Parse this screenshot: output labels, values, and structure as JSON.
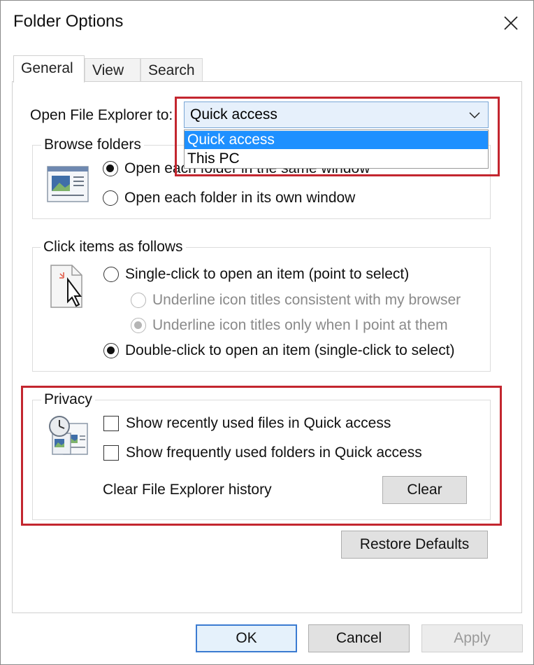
{
  "window": {
    "title": "Folder Options"
  },
  "tabs": [
    {
      "label": "General",
      "active": true
    },
    {
      "label": "View",
      "active": false
    },
    {
      "label": "Search",
      "active": false
    }
  ],
  "open_explorer": {
    "label": "Open File Explorer to:",
    "value": "Quick access",
    "options": [
      "Quick access",
      "This PC"
    ],
    "selected_index": 0
  },
  "browse_folders": {
    "legend": "Browse folders",
    "options": [
      {
        "label": "Open each folder in the same window",
        "checked": true
      },
      {
        "label": "Open each folder in its own window",
        "checked": false
      }
    ]
  },
  "click_items": {
    "legend": "Click items as follows",
    "options": [
      {
        "label": "Single-click to open an item (point to select)",
        "checked": false,
        "enabled": true
      },
      {
        "label": "Underline icon titles consistent with my browser",
        "checked": false,
        "enabled": false
      },
      {
        "label": "Underline icon titles only when I point at them",
        "checked": true,
        "enabled": false
      },
      {
        "label": "Double-click to open an item (single-click to select)",
        "checked": true,
        "enabled": true
      }
    ]
  },
  "privacy": {
    "legend": "Privacy",
    "checkboxes": [
      {
        "label": "Show recently used files in Quick access",
        "checked": false
      },
      {
        "label": "Show frequently used folders in Quick access",
        "checked": false
      }
    ],
    "clear_label": "Clear File Explorer history",
    "clear_button": "Clear"
  },
  "buttons": {
    "restore_defaults": "Restore Defaults",
    "ok": "OK",
    "cancel": "Cancel",
    "apply": "Apply"
  },
  "colors": {
    "highlight": "#c3262f",
    "dropdown_selection": "#1e90ff",
    "default_button_border": "#3b7bd1"
  }
}
